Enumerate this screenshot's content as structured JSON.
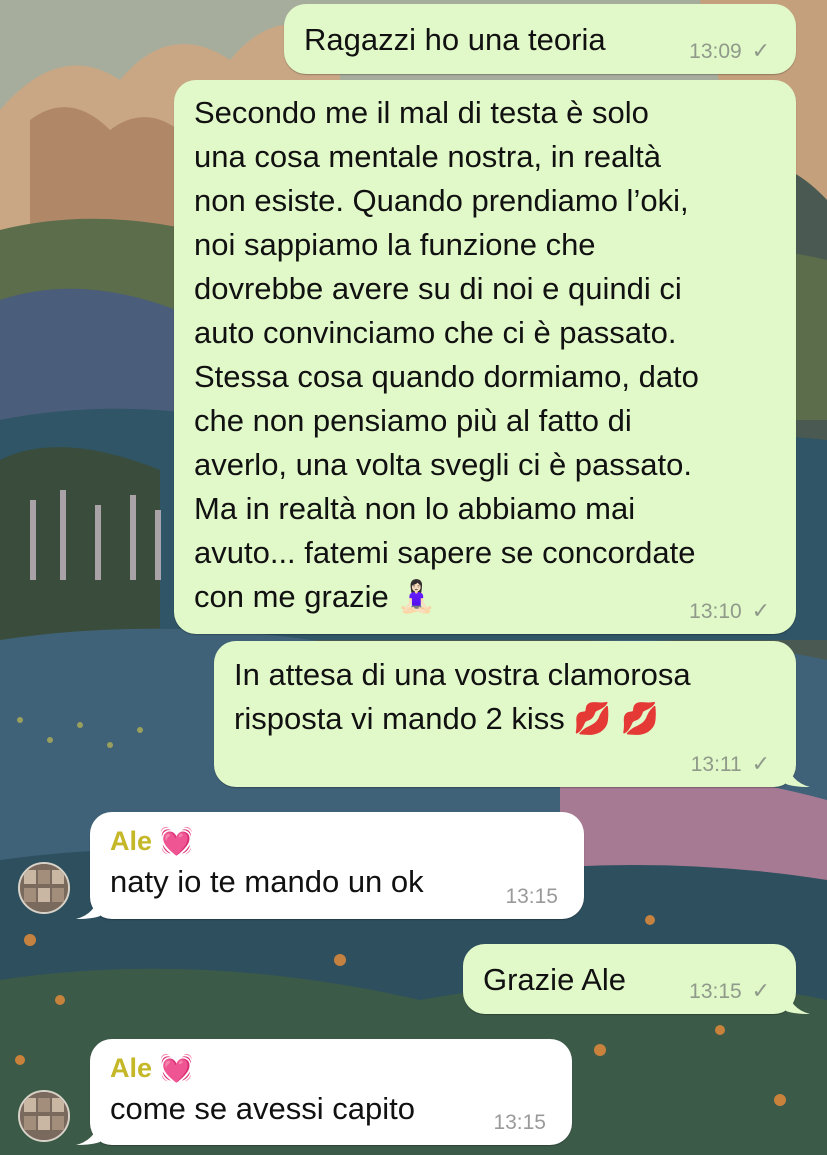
{
  "colors": {
    "outgoing_bubble": "#e1f8c9",
    "incoming_bubble": "#ffffff",
    "sender_name": "#c4b728",
    "timestamp": "#8f9a8a"
  },
  "messages": [
    {
      "direction": "out",
      "text": "Ragazzi ho una teoria",
      "time": "13:09",
      "status_icon": "single-check-icon"
    },
    {
      "direction": "out",
      "text": "Secondo me il mal di testa è solo\nuna cosa mentale nostra, in realtà\nnon esiste. Quando prendiamo l’oki,\nnoi sappiamo la funzione che\ndovrebbe avere su di noi e quindi ci\nauto convinciamo che ci è passato.\nStessa cosa quando dormiamo, dato\nche non pensiamo più al fatto di\naverlo, una volta svegli ci è passato.\nMa in realtà non lo abbiamo mai\navuto... fatemi sapere se concordate\ncon me grazie 🧘🏻‍♀️",
      "time": "13:10",
      "status_icon": "single-check-icon"
    },
    {
      "direction": "out",
      "text": "In attesa di una vostra clamorosa\nrisposta vi mando 2 kiss 💋 💋",
      "time": "13:11",
      "status_icon": "single-check-icon"
    },
    {
      "direction": "in",
      "sender": "Ale 💓",
      "text": "naty io te mando un ok",
      "time": "13:15",
      "avatar_icon": "contact-avatar"
    },
    {
      "direction": "out",
      "text": "Grazie Ale",
      "time": "13:15",
      "status_icon": "single-check-icon"
    },
    {
      "direction": "in",
      "sender": "Ale 💓",
      "text": "come se avessi capito",
      "time": "13:15",
      "avatar_icon": "contact-avatar"
    }
  ]
}
